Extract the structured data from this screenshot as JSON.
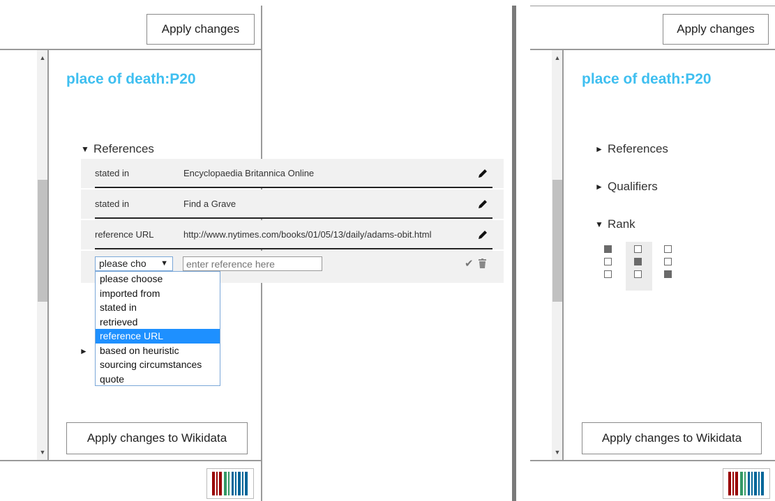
{
  "left_panel": {
    "apply_top": "Apply changes",
    "title": "place of death:P20",
    "references_label": "References",
    "references": [
      {
        "property": "stated in",
        "value": "Encyclopaedia Britannica Online"
      },
      {
        "property": "stated in",
        "value": "Find a Grave"
      },
      {
        "property": "reference URL",
        "value": "http://www.nytimes.com/books/01/05/13/daily/adams-obit.html"
      }
    ],
    "new_reference": {
      "select_value": "please cho",
      "input_placeholder": "enter reference here"
    },
    "dropdown_options": [
      "please choose",
      "imported from",
      "stated in",
      "retrieved",
      "reference URL",
      "based on heuristic",
      "sourcing circumstances",
      "quote"
    ],
    "dropdown_selected": "reference URL",
    "apply_bottom": "Apply changes to Wikidata"
  },
  "right_panel": {
    "apply_top": "Apply changes",
    "title": "place of death:P20",
    "references_label": "References",
    "qualifiers_label": "Qualifiers",
    "rank_label": "Rank",
    "rank_selected": "normal",
    "apply_bottom": "Apply changes to Wikidata"
  },
  "colors": {
    "title": "#3fbff0",
    "dropdown_highlight": "#1e90ff",
    "divider": "#7a7a7a"
  }
}
